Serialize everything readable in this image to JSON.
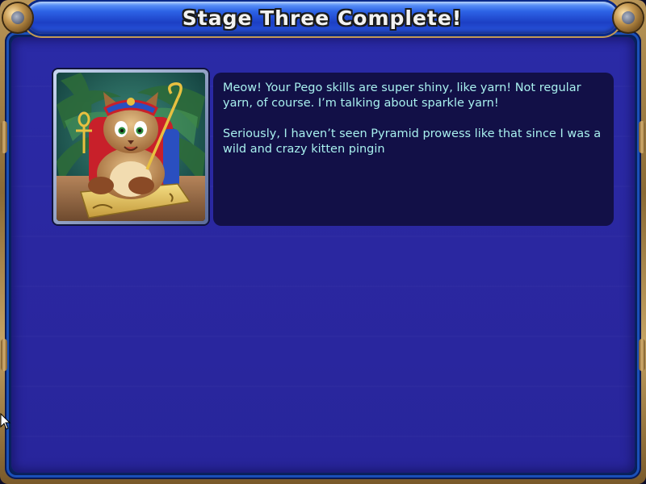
{
  "header": {
    "title": "Stage Three Complete!"
  },
  "dialog": {
    "paragraph1": [
      "Meow!  Your Pego skills are super shiny, like yarn!  Not regular",
      "yarn, of course.  I’m talking about sparkle yarn!"
    ],
    "paragraph2": [
      "Seriously, I haven’t seen Pyramid prowess like that since I was a",
      "wild and crazy kitten pingin"
    ]
  },
  "portrait": {
    "subject": "pharaoh-cat-character",
    "icon": "pharaoh-cat-icon"
  },
  "colors": {
    "panel_bg": "#2a2aa6",
    "dialog_bg": "#121047",
    "dialog_text": "#a8f0ee",
    "title_bar": "#1c3fc4",
    "frame_gold": "#b89558"
  }
}
